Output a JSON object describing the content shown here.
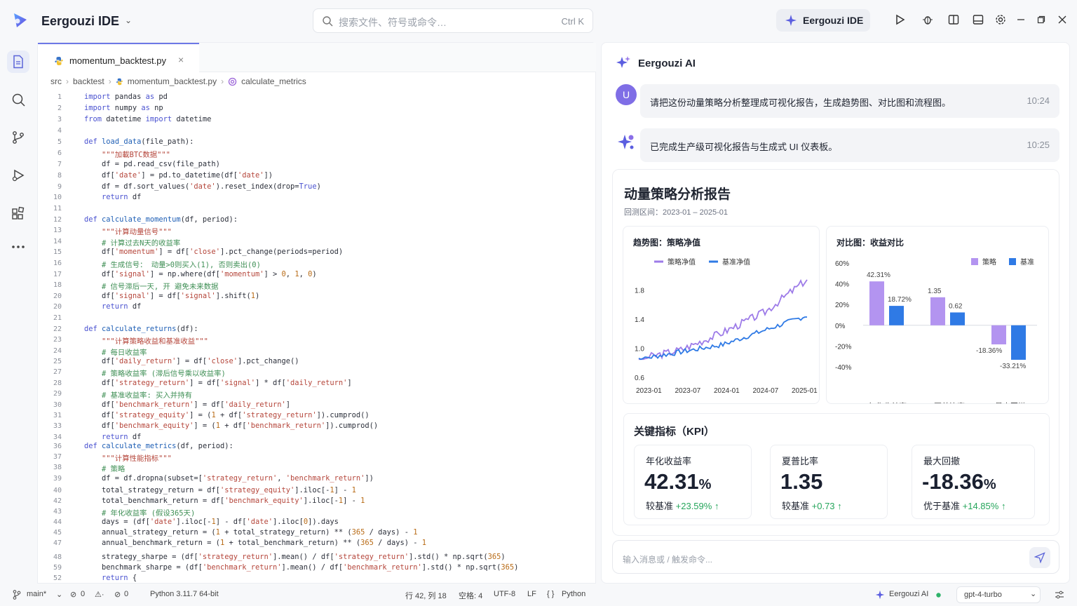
{
  "app": {
    "title": "Eergouzi IDE"
  },
  "search": {
    "placeholder": "搜索文件、符号或命令…",
    "shortcut": "Ctrl K"
  },
  "toolbar": {
    "ai_label": "Eergouzi IDE"
  },
  "tab": {
    "filename": "momentum_backtest.py",
    "close": "×"
  },
  "breadcrumb": [
    "src",
    "backtest",
    "momentum_backtest.py",
    "calculate_metrics"
  ],
  "code": [
    {
      "n": "1",
      "t": "<span class='kw'>import</span> pandas <span class='kw'>as</span> pd"
    },
    {
      "n": "2",
      "t": "<span class='kw'>import</span> numpy <span class='kw'>as</span> np"
    },
    {
      "n": "3",
      "t": "<span class='kw'>from</span> datetime <span class='kw'>import</span> datetime"
    },
    {
      "n": "4",
      "t": ""
    },
    {
      "n": "5",
      "t": "<span class='kw'>def</span> <span class='fnn'>load_data</span>(file_path):"
    },
    {
      "n": "6",
      "t": "    <span class='st'>\"\"\"加載BTC数据\"\"\"</span>"
    },
    {
      "n": "7",
      "t": "    df = pd.read_csv(file_path)"
    },
    {
      "n": "8",
      "t": "    df[<span class='st'>'date'</span>] = pd.to_datetime(df[<span class='st'>'date'</span>])"
    },
    {
      "n": "9",
      "t": "    df = df.sort_values(<span class='st'>'date'</span>).reset_index(drop=<span class='kw'>True</span>)"
    },
    {
      "n": "10",
      "t": "    <span class='kw'>return</span> df"
    },
    {
      "n": "11",
      "t": ""
    },
    {
      "n": "12",
      "t": "<span class='kw'>def</span> <span class='fnn'>calculate_momentum</span>(df, period):"
    },
    {
      "n": "13",
      "t": "    <span class='st'>\"\"\"计算动量信号\"\"\"</span>"
    },
    {
      "n": "14",
      "t": "    <span class='cm'># 计算过去N天的收益率</span>"
    },
    {
      "n": "15",
      "t": "    df[<span class='st'>'momentum'</span>] = df[<span class='st'>'close'</span>].pct_change(periods=period)"
    },
    {
      "n": "16",
      "t": "    <span class='cm'># 生成信号： 动量&gt;0则买入(1), 否则卖出(0)</span>"
    },
    {
      "n": "17",
      "t": "    df[<span class='st'>'signal'</span>] = np.where(df[<span class='st'>'momentum'</span>] &gt; <span class='nm'>0</span>, <span class='nm'>1</span>, <span class='nm'>0</span>)"
    },
    {
      "n": "18",
      "t": "    <span class='cm'># 信号滞后一天, 开 避免未来数据</span>"
    },
    {
      "n": "20",
      "t": "    df[<span class='st'>'signal'</span>] = df[<span class='st'>'signal'</span>].shift(<span class='nm'>1</span>)"
    },
    {
      "n": "20",
      "t": "    <span class='kw'>return</span> df"
    },
    {
      "n": "21",
      "t": ""
    },
    {
      "n": "22",
      "t": "<span class='kw'>def</span> <span class='fnn'>calculate_returns</span>(df):"
    },
    {
      "n": "23",
      "t": "    <span class='st'>\"\"\"计算策略收益和基准收益\"\"\"</span>"
    },
    {
      "n": "24",
      "t": "    <span class='cm'># 每日收益率</span>"
    },
    {
      "n": "25",
      "t": "    df[<span class='st'>'daily_return'</span>] = df[<span class='st'>'close'</span>].pct_change()"
    },
    {
      "n": "27",
      "t": "    <span class='cm'># 策略收益率 (滞后信号乘以收益率)</span>"
    },
    {
      "n": "28",
      "t": "    df[<span class='st'>'strategy_return'</span>] = df[<span class='st'>'signal'</span>] * df[<span class='st'>'daily_return'</span>]"
    },
    {
      "n": "29",
      "t": "    <span class='cm'># 基准收益率: 买入并持有</span>"
    },
    {
      "n": "30",
      "t": "    df[<span class='st'>'benchmark_return'</span>] = df[<span class='st'>'daily_return'</span>]"
    },
    {
      "n": "31",
      "t": "    df[<span class='st'>'strategy_equity'</span>] = (<span class='nm'>1</span> + df[<span class='st'>'strategy_return'</span>]).cumprod()"
    },
    {
      "n": "33",
      "t": "    df[<span class='st'>'benchmark_equity'</span>] = (<span class='nm'>1</span> + df[<span class='st'>'benchmark_return'</span>]).cumprod()"
    },
    {
      "n": "34",
      "t": "    <span class='kw'>return</span> df"
    },
    {
      "n": "36",
      "t": "<span class='kw'>def</span> <span class='fnn'>calculate_metrics</span>(df, period):"
    },
    {
      "n": "37",
      "t": "    <span class='st'>\"\"\"计算性能指标\"\"\"</span>"
    },
    {
      "n": "38",
      "t": "    <span class='cm'># 策略</span>"
    },
    {
      "n": "39",
      "t": "    df = df.dropna(subset=[<span class='st'>'strategy_return'</span>, <span class='st'>'benchmark_return'</span>])"
    },
    {
      "n": "40",
      "t": "    total_strategy_return = df[<span class='st'>'strategy_equity'</span>].iloc[-<span class='nm'>1</span>] - <span class='nm'>1</span>"
    },
    {
      "n": "42",
      "t": "    total_benchmark_return = df[<span class='st'>'benchmark_equity'</span>].iloc[-<span class='nm'>1</span>] - <span class='nm'>1</span>"
    },
    {
      "n": "43",
      "t": "    <span class='cm'># 年化收益率 (假设365天)</span>"
    },
    {
      "n": "44",
      "t": "    days = (df[<span class='st'>'date'</span>].iloc[-<span class='nm'>1</span>] - df[<span class='st'>'date'</span>].iloc[<span class='nm'>0</span>]).days"
    },
    {
      "n": "45",
      "t": "    annual_strategy_return = (<span class='nm'>1</span> + total_strategy_return) ** (<span class='nm'>365</span> / days) - <span class='nm'>1</span>"
    },
    {
      "n": "47",
      "t": "    annual_benchmark_return = (<span class='nm'>1</span> + total_benchmark_return) ** (<span class='nm'>365</span> / days) - <span class='nm'>1</span>"
    },
    {
      "n": "48",
      "t": "    strategy_sharpe = (df[<span class='st'>'strategy_return'</span>].mean() / df[<span class='st'>'strategy_return'</span>].std() * np.sqrt(<span class='nm'>365</span>)"
    },
    {
      "n": "59",
      "t": "    benchmark_sharpe = (df[<span class='st'>'benchmark_return'</span>].mean() / df[<span class='st'>'benchmark_return'</span>].std() * np.sqrt(<span class='nm'>365</span>)"
    },
    {
      "n": "52",
      "t": "    <span class='kw'>return</span> {"
    }
  ],
  "ai_panel": {
    "title": "Eergouzi AI",
    "user_avatar": "U",
    "user_msg": "请把这份动量策略分析整理成可视化报告，生成趋势图、对比图和流程图。",
    "user_time": "10:24",
    "ai_msg": "已完成生产级可视化报告与生成式 UI 仪表板。",
    "ai_time": "10:25",
    "input_placeholder": "输入消息或 / 触发命令..."
  },
  "report": {
    "title": "动量策略分析报告",
    "subtitle": "回测区间：2023-01 – 2025-01",
    "trend_title": "趋势图：策略净值",
    "compare_title": "对比图：收益对比",
    "kpi_title": "关键指标（KPI）"
  },
  "chart_data": [
    {
      "type": "line",
      "title": "趋势图：策略净值",
      "x": [
        "2023-01",
        "2023-07",
        "2024-01",
        "2024-07",
        "2025-01"
      ],
      "series": [
        {
          "name": "策略净值",
          "color": "#9d7be8",
          "values": [
            0.85,
            0.98,
            1.22,
            1.5,
            1.95
          ]
        },
        {
          "name": "基准净值",
          "color": "#2f7ae5",
          "values": [
            0.85,
            0.95,
            1.05,
            1.25,
            1.45
          ]
        }
      ],
      "yticks": [
        "1.8",
        "1.4",
        "1.0",
        "0.6"
      ],
      "ylim": [
        0.6,
        2.0
      ]
    },
    {
      "type": "bar",
      "title": "对比图：收益对比",
      "categories": [
        "年化收益率",
        "夏普比率",
        "最大回撤"
      ],
      "series": [
        {
          "name": "策略",
          "color": "#b394f0",
          "values": [
            42.31,
            1.35,
            -18.36
          ],
          "labels": [
            "42.31%",
            "1.35",
            "-18.36%"
          ]
        },
        {
          "name": "基准",
          "color": "#2f7ae5",
          "values": [
            18.72,
            0.62,
            -33.21
          ],
          "labels": [
            "18.72%",
            "0.62",
            "-33.21%"
          ]
        }
      ],
      "yticks": [
        "60%",
        "40%",
        "20%",
        "0%",
        "-20%",
        "-40%"
      ],
      "ylim": [
        -40,
        60
      ]
    }
  ],
  "kpis": [
    {
      "name": "年化收益率",
      "value": "42.31",
      "unit": "%",
      "cmp": "较基准",
      "delta": "+23.59%",
      "arrow": "↑"
    },
    {
      "name": "夏普比率",
      "value": "1.35",
      "unit": "",
      "cmp": "较基准",
      "delta": "+0.73",
      "arrow": "↑"
    },
    {
      "name": "最大回撤",
      "value": "-18.36",
      "unit": "%",
      "cmp": "优于基准",
      "delta": "+14.85%",
      "arrow": "↑"
    }
  ],
  "statusbar": {
    "branch": "main*",
    "errors": "0",
    "warnings": "0",
    "ports": "0",
    "python": "Python  3.11.7  64-bit",
    "position": "行 42, 列 18",
    "spaces": "空格: 4",
    "encoding": "UTF-8",
    "eol": "LF",
    "language": "Python",
    "ai": "Eergouzi AI",
    "model": "gpt-4-turbo"
  }
}
